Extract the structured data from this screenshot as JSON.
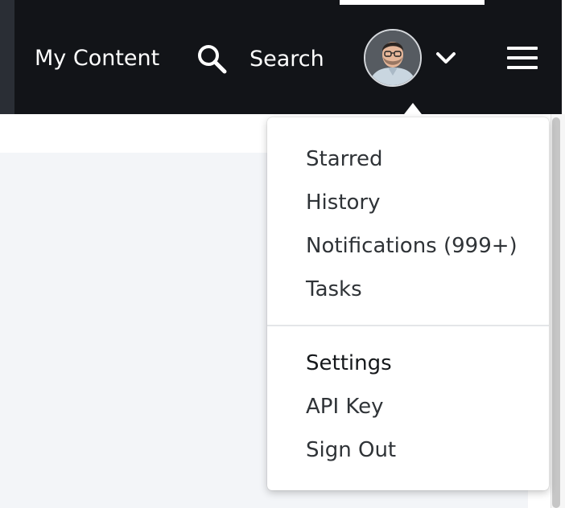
{
  "header": {
    "my_content": "My Content",
    "search_label": "Search",
    "avatar_icon": "user-avatar",
    "chevron_icon": "chevron-down-icon",
    "menu_icon": "hamburger-menu-icon"
  },
  "user_menu": {
    "items": [
      {
        "label": "Starred"
      },
      {
        "label": "History"
      },
      {
        "label": "Notifications (999+)"
      },
      {
        "label": "Tasks"
      },
      {
        "label": "Settings"
      },
      {
        "label": "API Key"
      },
      {
        "label": "Sign Out"
      }
    ]
  },
  "colors": {
    "header_background": "#121418",
    "content_background": "#f3f5f8",
    "menu_text": "#2f3337"
  }
}
